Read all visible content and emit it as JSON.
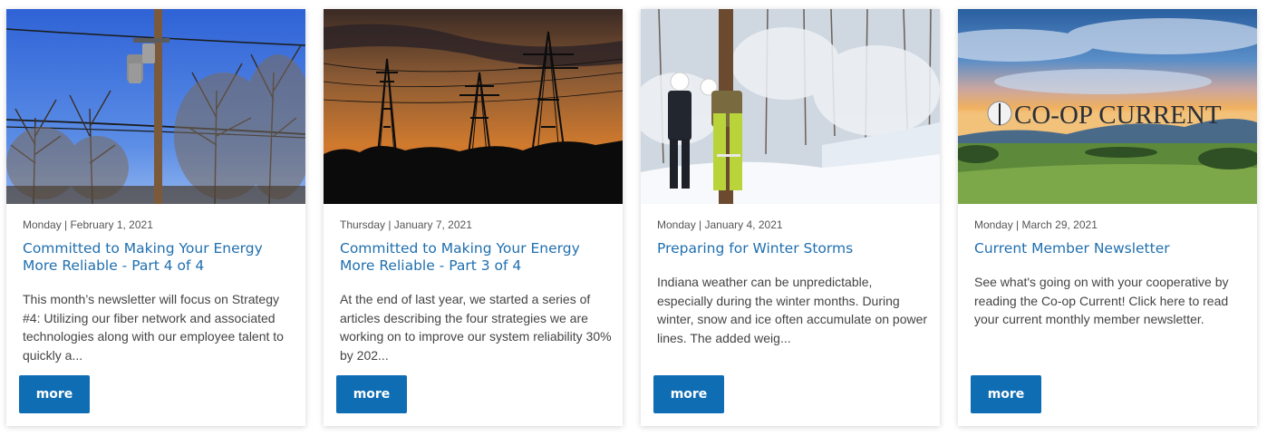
{
  "cards": [
    {
      "date": "Monday | February 1, 2021",
      "title": "Committed to Making Your Energy More Reliable - Part 4 of 4",
      "excerpt": "This month’s newsletter will focus on Strategy #4: Utilizing our fiber network and associated technologies along with our employee talent to quickly a...",
      "button": "more"
    },
    {
      "date": "Thursday | January 7, 2021",
      "title": "Committed to Making Your Energy More Reliable - Part 3 of 4",
      "excerpt": "At the end of last year, we started a series of articles describing the four strategies we are working on to improve our system reliability 30% by 202...",
      "button": "more"
    },
    {
      "date": "Monday | January 4, 2021",
      "title": "Preparing for Winter Storms",
      "excerpt": "Indiana weather can be unpredictable, especially during the winter months. During winter, snow and ice often accumulate on power lines. The added weig...",
      "button": "more"
    },
    {
      "date": "Monday | March 29, 2021",
      "title": "Current Member Newsletter",
      "excerpt": "See what's going on with your cooperative by reading the Co-op Current! Click here to read your current monthly member newsletter.",
      "button": "more",
      "image_text": "CO-OP CURRENT"
    }
  ],
  "colors": {
    "link": "#1f6faf",
    "button": "#0f6db4"
  }
}
